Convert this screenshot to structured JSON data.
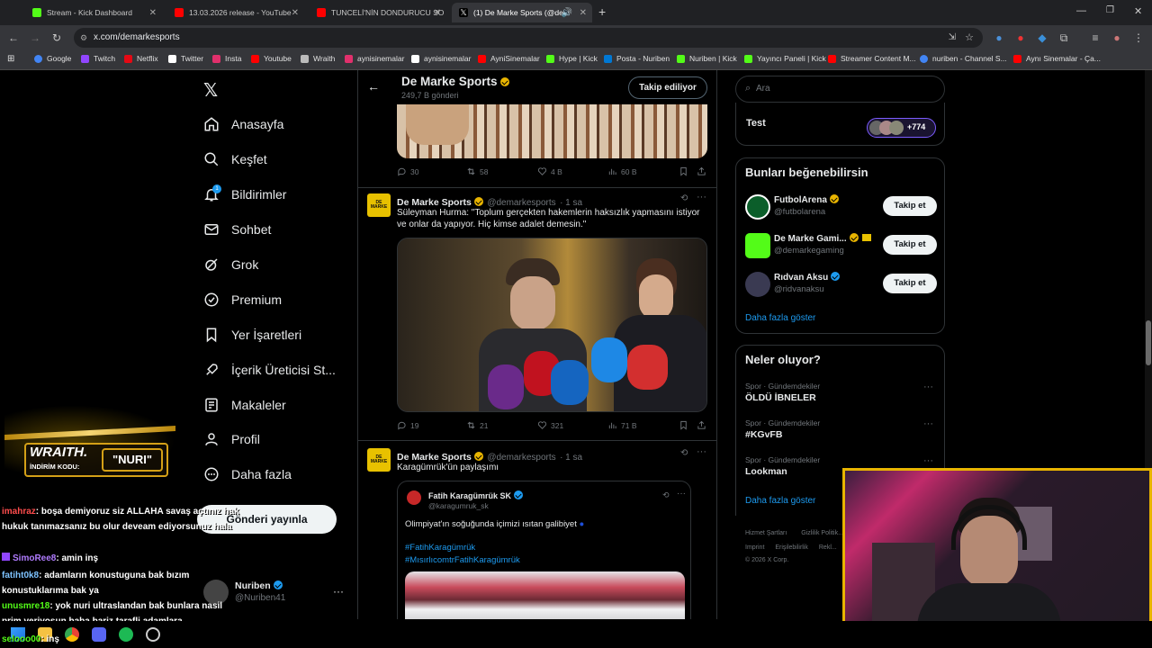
{
  "browser": {
    "tabs": [
      {
        "label": "Stream - Kick Dashboard",
        "color": "#53fc18"
      },
      {
        "label": "13.03.2026 release - YouTube",
        "color": "#ff0000"
      },
      {
        "label": "TUNCELİ'NİN DONDURUCU SO",
        "color": "#ff0000"
      },
      {
        "label": "(1) De Marke Sports (@dem",
        "color": "#ffffff"
      }
    ],
    "new_tab": "+",
    "url": "x.com/demarkesports",
    "bookmarks": [
      {
        "label": "Google",
        "color": "#4285f4"
      },
      {
        "label": "Twitch",
        "color": "#9146ff"
      },
      {
        "label": "Netflix",
        "color": "#e50914"
      },
      {
        "label": "Twitter",
        "color": "#ffffff"
      },
      {
        "label": "Insta",
        "color": "#e1306c"
      },
      {
        "label": "Youtube",
        "color": "#ff0000"
      },
      {
        "label": "Wraith",
        "color": "#bbbbbb"
      },
      {
        "label": "aynisinemalar",
        "color": "#e1306c"
      },
      {
        "label": "aynisinemalar",
        "color": "#ffffff"
      },
      {
        "label": "AyniSinemalar",
        "color": "#ff0000"
      },
      {
        "label": "Hype | Kick",
        "color": "#53fc18"
      },
      {
        "label": "Posta - Nuriben",
        "color": "#0078d4"
      },
      {
        "label": "Nuriben | Kick",
        "color": "#53fc18"
      },
      {
        "label": "Yayıncı Paneli | Kick",
        "color": "#53fc18"
      },
      {
        "label": "Streamer Content M...",
        "color": "#ff0000"
      },
      {
        "label": "nuriben - Channel S...",
        "color": "#4285f4"
      },
      {
        "label": "Aynı Sinemalar - Ça...",
        "color": "#ff0000"
      }
    ]
  },
  "x_nav": {
    "items": [
      "Anasayfa",
      "Keşfet",
      "Bildirimler",
      "Sohbet",
      "Grok",
      "Premium",
      "Yer İşaretleri",
      "İçerik Üreticisi St...",
      "Makaleler",
      "Profil",
      "Daha fazla"
    ],
    "notification_count": "1",
    "post_button": "Gönderi yayınla",
    "account_name": "Nuriben",
    "account_handle": "@Nuriben41"
  },
  "profile_header": {
    "name": "De Marke Sports",
    "posts": "249,7 B gönderi",
    "following_button": "Takip ediliyor"
  },
  "tweets": [
    {
      "actions": {
        "replies": "30",
        "retweets": "58",
        "likes": "4 B",
        "views": "60 B"
      }
    },
    {
      "author": "De Marke Sports",
      "handle": "@demarkesports",
      "time": "· 1 sa",
      "text": "Süleyman Hurma: \"Toplum gerçekten hakemlerin haksızlık yapmasını istiyor ve onlar da yapıyor. Hiç kimse adalet demesin.\"",
      "actions": {
        "replies": "19",
        "retweets": "21",
        "likes": "321",
        "views": "71 B"
      }
    },
    {
      "author": "De Marke Sports",
      "handle": "@demarkesports",
      "time": "· 1 sa",
      "text": "Karagümrük'ün paylaşımı",
      "quote": {
        "author": "Fatih Karagümrük SK",
        "handle": "@karagumruk_sk",
        "text": "Olimpiyat'ın soğuğunda içimizi ısıtan galibiyet",
        "hashtags": [
          "#FatihKaragümrük",
          "#MısırlıcomtrFatihKaragümrük"
        ]
      }
    }
  ],
  "right": {
    "search_placeholder": "Ara",
    "test_label": "Test",
    "test_count": "+774",
    "suggest_title": "Bunları beğenebilirsin",
    "suggestions": [
      {
        "name": "FutbolArena",
        "handle": "@futbolarena",
        "button": "Takip et"
      },
      {
        "name": "De Marke Gami...",
        "handle": "@demarkegaming",
        "button": "Takip et"
      },
      {
        "name": "Rıdvan Aksu",
        "handle": "@ridvanaksu",
        "button": "Takip et"
      }
    ],
    "show_more": "Daha fazla göster",
    "trends_title": "Neler oluyor?",
    "trends": [
      {
        "meta": "Spor · Gündemdekiler",
        "name": "ÖLDÜ İBNELER"
      },
      {
        "meta": "Spor · Gündemdekiler",
        "name": "#KGvFB"
      },
      {
        "meta": "Spor · Gündemdekiler",
        "name": "Lookman"
      }
    ],
    "trends_more": "Daha fazla göster",
    "footer": [
      "Hizmet Şartları",
      "Gizlilik Politik...",
      "Imprint",
      "Erişilebilirlik",
      "Rekl...",
      "© 2026 X Corp."
    ]
  },
  "overlay": {
    "sponsor_brand": "WRAITH.",
    "sponsor_code_label": "İNDİRİM KODU:",
    "sponsor_code": "\"NURI\"",
    "chat": [
      {
        "user": "imahraz",
        "text": ": boşa demiyoruz siz ALLAHA savaş açtınız hak hukuk tanımazsanız bu olur deveam ediyorsunuz hala",
        "color": "#ff4d4d"
      },
      {
        "user": "SimoRee8",
        "text": ": amin inş",
        "color": "#b07cff"
      },
      {
        "user": "fatiht0k8",
        "text": ": adamların konustuguna bak bızım konustuklarıma bak ya",
        "color": "#7ec3ff"
      },
      {
        "user": "unusmre18",
        "text": ": yok nuri ultraslandan bak bunlara nasil prim veriyosun baba bariz tarafli adamlara",
        "color": "#53fc18"
      },
      {
        "user": "selooo00",
        "text": ": inş",
        "color": "#53fc18"
      }
    ]
  }
}
